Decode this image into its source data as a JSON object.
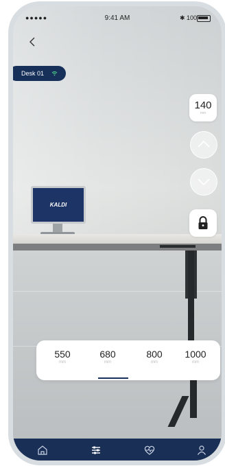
{
  "status_bar": {
    "signal": "●●●●● ",
    "time": "9:41 AM",
    "battery": "✱ 100"
  },
  "device": {
    "name": "Desk 01"
  },
  "height": {
    "value": "140",
    "unit": "mm"
  },
  "monitor_logo": "KALDI",
  "presets": [
    {
      "value": "550",
      "unit": "mm"
    },
    {
      "value": "680",
      "unit": "mm"
    },
    {
      "value": "800",
      "unit": "mm"
    },
    {
      "value": "1000",
      "unit": "mm"
    }
  ],
  "selected_preset": "680",
  "icons": {
    "back": "chevron-left-icon",
    "wifi": "wifi-icon",
    "up": "chevron-up-icon",
    "down": "chevron-down-icon",
    "lock": "lock-icon",
    "tabs": [
      "home-icon",
      "sliders-icon",
      "heart-pulse-icon",
      "user-icon"
    ]
  },
  "colors": {
    "accent": "#17305a",
    "tabbar": "#1a2f55",
    "wifi": "#4fd68a"
  }
}
